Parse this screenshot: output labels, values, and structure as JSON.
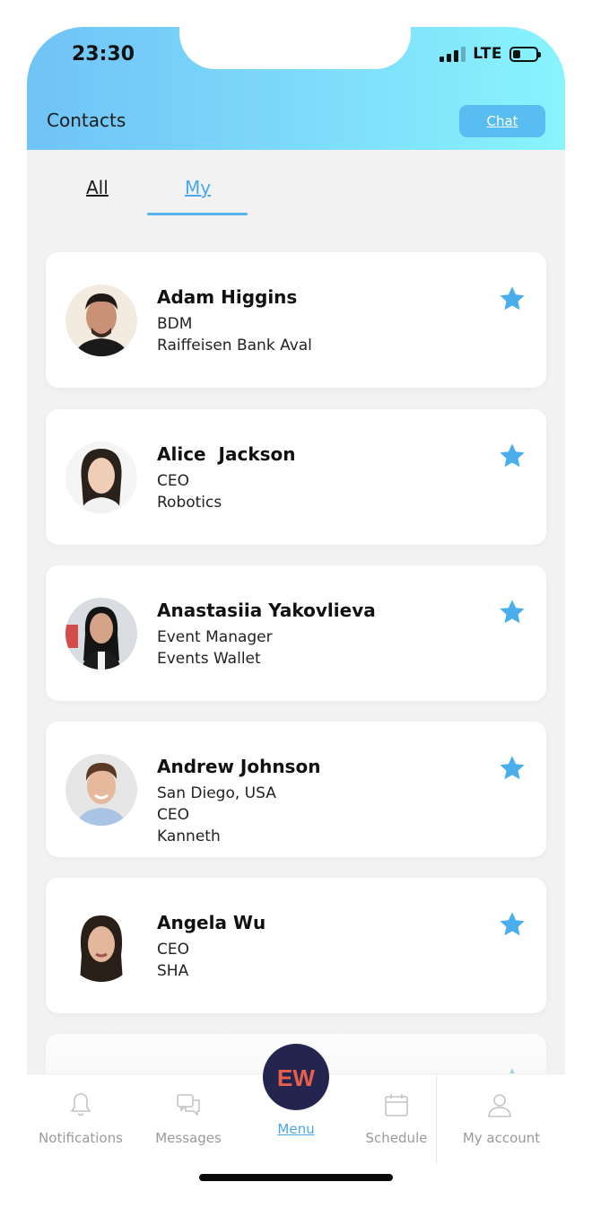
{
  "status_bar": {
    "time": "23:30",
    "network": "LTE"
  },
  "header": {
    "title": "Contacts",
    "chat_label": "Chat"
  },
  "tabs": [
    {
      "label": "All",
      "active": false
    },
    {
      "label": "My",
      "active": true
    }
  ],
  "contacts": [
    {
      "name": "Adam Higgins",
      "lines": [
        "BDM",
        "Raiffeisen Bank Aval"
      ],
      "favorite": true
    },
    {
      "name": "Alice  Jackson",
      "lines": [
        "CEO",
        "Robotics"
      ],
      "favorite": true
    },
    {
      "name": "Anastasiia Yakovlieva",
      "lines": [
        "Event Manager",
        "Events Wallet"
      ],
      "favorite": true
    },
    {
      "name": "Andrew Johnson",
      "lines": [
        "San Diego, USA",
        "CEO",
        "Kanneth"
      ],
      "favorite": true
    },
    {
      "name": "Angela Wu",
      "lines": [
        "CEO",
        "SHA"
      ],
      "favorite": true
    }
  ],
  "bottom_nav": {
    "items": [
      {
        "label": "Notifications",
        "icon": "bell-icon"
      },
      {
        "label": "Messages",
        "icon": "chat-bubbles-icon"
      },
      {
        "label": "Menu",
        "icon": "ew-logo"
      },
      {
        "label": "Schedule",
        "icon": "calendar-icon"
      },
      {
        "label": "My account",
        "icon": "user-icon"
      }
    ],
    "logo_text": "EW"
  },
  "colors": {
    "accent": "#4aa8e8",
    "star": "#4aaeec",
    "header_gradient_start": "#6fc3f6",
    "header_gradient_end": "#88f4fd",
    "menu_button": "#24254f"
  }
}
